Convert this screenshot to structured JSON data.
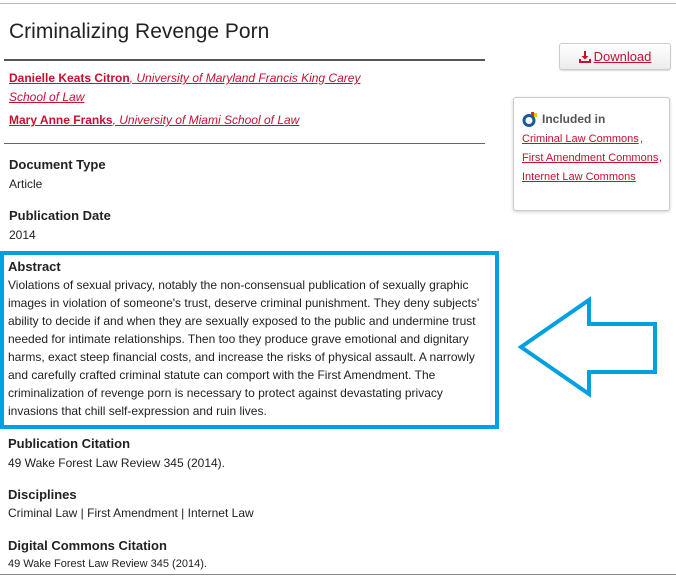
{
  "title": "Criminalizing Revenge Porn",
  "authors": [
    {
      "name": "Danielle Keats Citron",
      "affiliation_line1": ", University of Maryland Francis King Carey",
      "affiliation_line2": "School of Law"
    },
    {
      "name": "Mary Anne Franks",
      "affiliation": ", University of Miami School of Law"
    }
  ],
  "document_type": {
    "label": "Document Type",
    "value": "Article"
  },
  "publication_date": {
    "label": "Publication Date",
    "value": "2014"
  },
  "abstract": {
    "label": "Abstract",
    "text": "Violations of sexual privacy, notably the non-consensual publication of sexually graphic images in violation of someone's trust, deserve criminal punishment. They deny subjects' ability to decide if and when they are sexually exposed to the public and undermine trust needed for intimate relationships. Then too they produce grave emotional and dignitary harms, exact steep financial costs, and increase the risks of physical assault. A narrowly and carefully crafted criminal statute can comport with the First Amendment. The criminalization of revenge porn is necessary to protect against devastating privacy invasions that chill self-expression and ruin lives."
  },
  "publication_citation": {
    "label": "Publication Citation",
    "value": "49 Wake Forest Law Review 345 (2014)."
  },
  "disciplines": {
    "label": "Disciplines",
    "value": "Criminal Law | First Amendment | Internet Law"
  },
  "digital_commons_citation": {
    "label": "Digital Commons Citation",
    "value": "49 Wake Forest Law Review 345 (2014)."
  },
  "download": {
    "label": "Download",
    "icon": "download-icon"
  },
  "included_in": {
    "label": "Included in",
    "icon": "digital-commons-network-icon",
    "items": [
      "Criminal Law Commons",
      "First Amendment Commons",
      "Internet Law Commons"
    ]
  },
  "colors": {
    "accent": "#c8102e",
    "highlight": "#00a0e3"
  }
}
